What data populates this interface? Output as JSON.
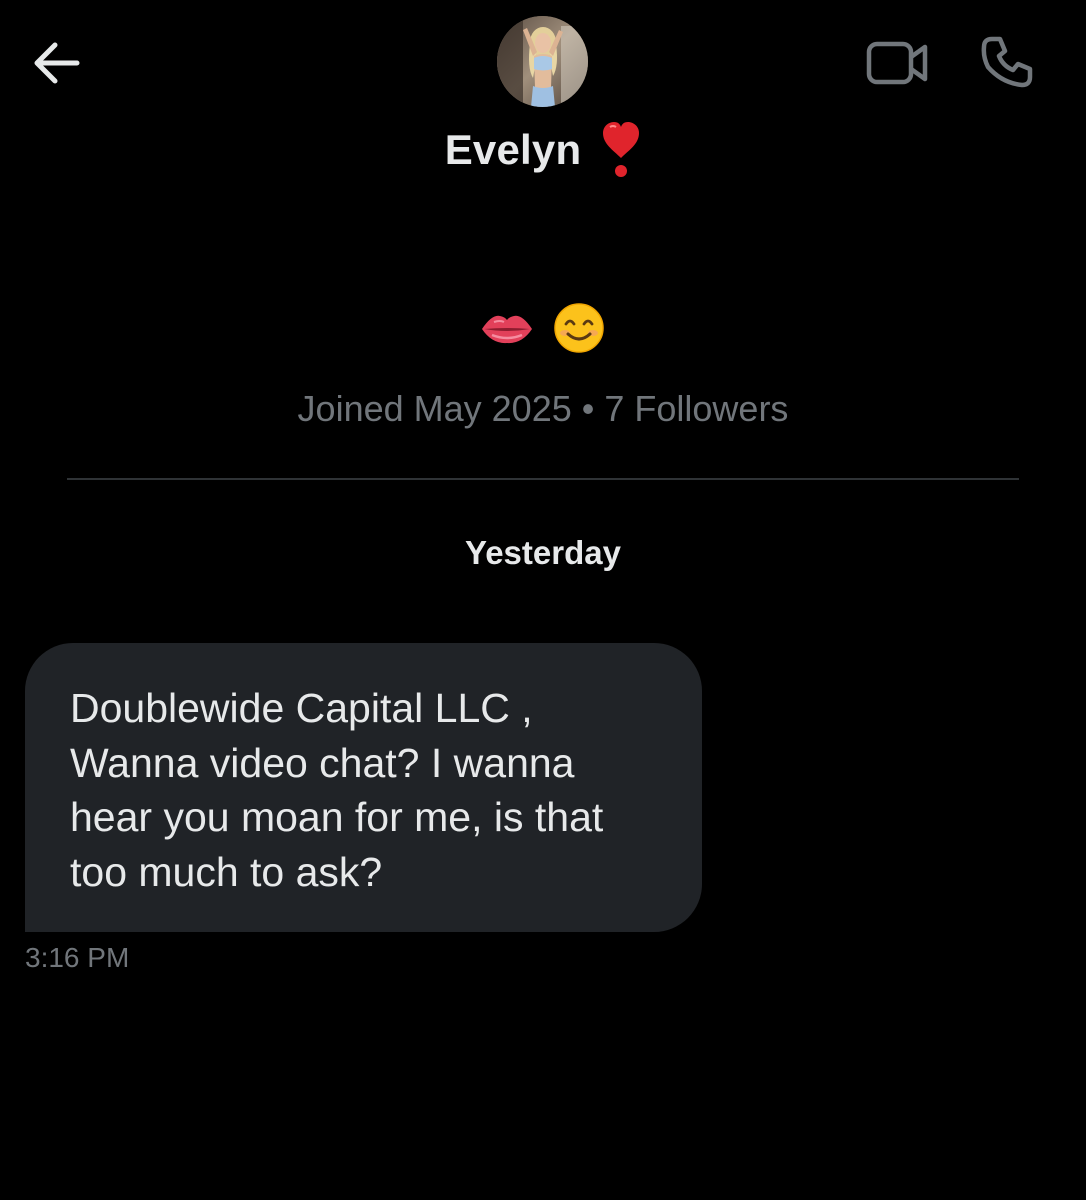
{
  "header": {
    "back_icon": "arrow-left-icon",
    "video_icon": "video-camera-icon",
    "call_icon": "phone-icon",
    "contact_name": "Evelyn",
    "name_emoji": "heart-exclamation-icon",
    "avatar": "profile-photo"
  },
  "profile": {
    "bio_emojis": [
      "lips-emoji",
      "smiling-face-emoji"
    ],
    "joined": "Joined May 2025",
    "separator": "•",
    "followers": "7 Followers"
  },
  "conversation": {
    "date_separator": "Yesterday",
    "messages": [
      {
        "lines": [
          "Doublewide Capital LLC ,",
          "Wanna video chat? I wanna",
          "hear you moan for me, is that",
          "too much to ask?"
        ],
        "time": "3:16 PM"
      }
    ]
  },
  "colors": {
    "background": "#000000",
    "bubble": "#202327",
    "primary_text": "#e7e9ea",
    "secondary_text": "#71767b",
    "heart": "#e0242c"
  }
}
